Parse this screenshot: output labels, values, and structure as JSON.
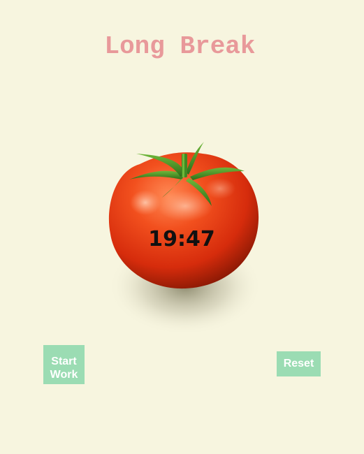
{
  "header": {
    "title": "Long Break"
  },
  "timer": {
    "display": "19:47"
  },
  "controls": {
    "start_label": "Start Work",
    "reset_label": "Reset"
  },
  "colors": {
    "background": "#f7f5df",
    "title": "#e8999a",
    "button": "#9bdcb3",
    "tomato": "#e8401c",
    "stem": "#3f8a22"
  },
  "icons": {
    "tomato": "tomato-icon"
  }
}
